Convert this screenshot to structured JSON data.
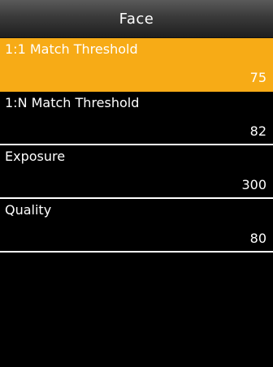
{
  "header": {
    "title": "Face"
  },
  "settings": [
    {
      "label": "1:1 Match Threshold",
      "value": "75",
      "selected": true
    },
    {
      "label": "1:N Match Threshold",
      "value": "82",
      "selected": false
    },
    {
      "label": "Exposure",
      "value": "300",
      "selected": false
    },
    {
      "label": "Quality",
      "value": "80",
      "selected": false
    }
  ],
  "colors": {
    "selected_background": "#f7ab16",
    "background": "#000000",
    "text": "#ffffff"
  }
}
